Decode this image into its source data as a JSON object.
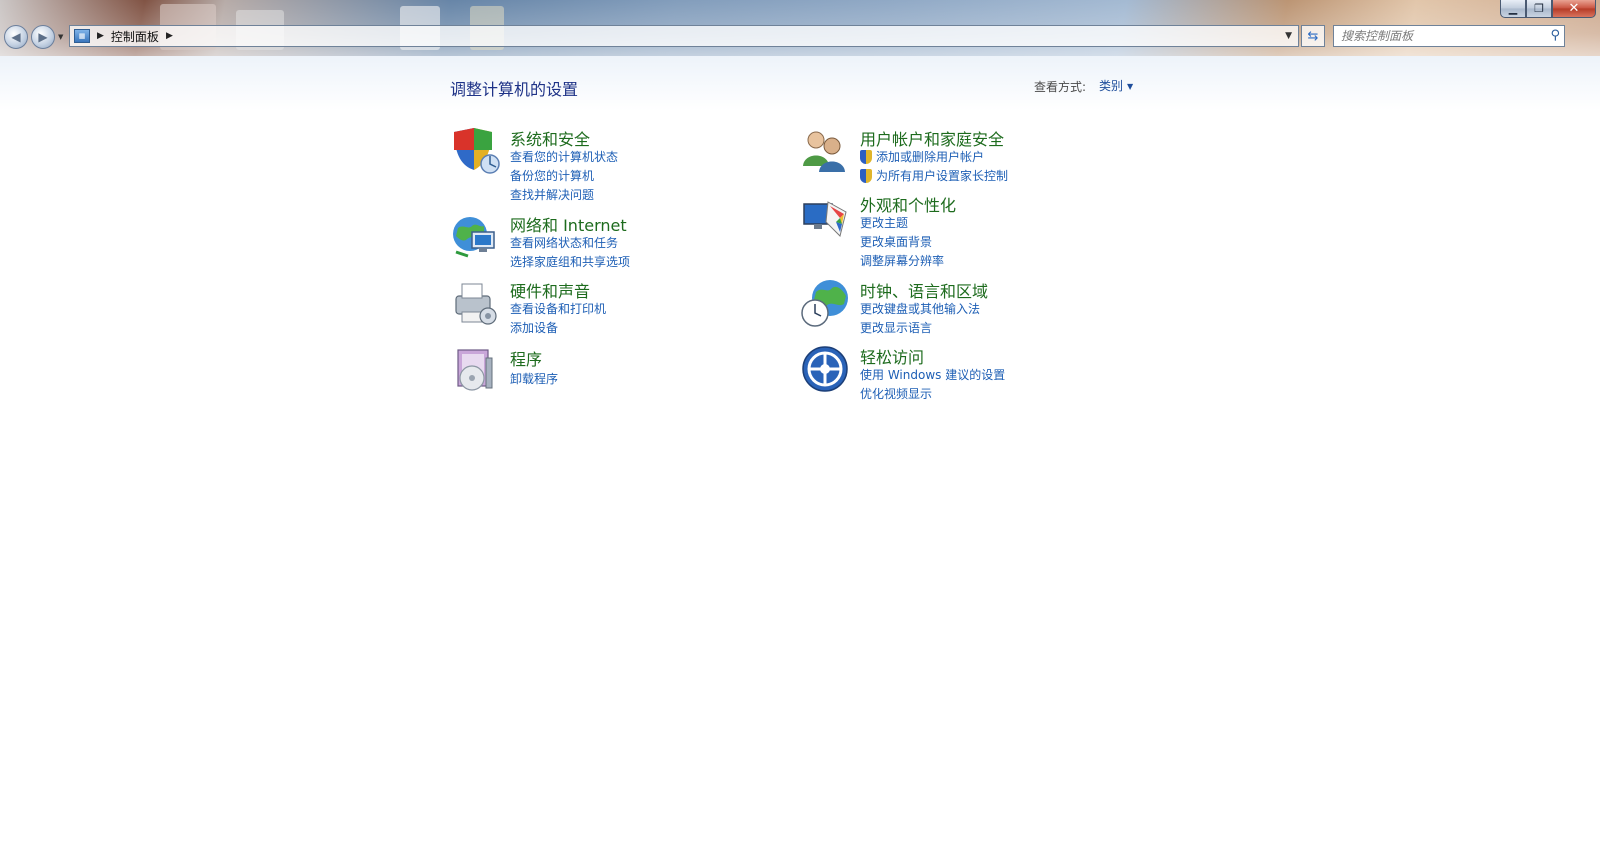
{
  "window": {
    "controls": {
      "minimize": "▁",
      "maximize": "❐",
      "close": "✕"
    }
  },
  "address_bar": {
    "breadcrumb": [
      "控制面板"
    ],
    "icon": "control-panel-icon"
  },
  "search": {
    "placeholder": "搜索控制面板"
  },
  "header": {
    "title": "调整计算机的设置",
    "view_by_label": "查看方式:",
    "view_by_value": "类别"
  },
  "categories": [
    {
      "id": "system-security",
      "icon": "shield-icon",
      "title": "系统和安全",
      "links": [
        "查看您的计算机状态",
        "备份您的计算机",
        "查找并解决问题"
      ]
    },
    {
      "id": "user-accounts",
      "icon": "users-icon",
      "title": "用户帐户和家庭安全",
      "links": [
        "添加或删除用户帐户",
        "为所有用户设置家长控制"
      ]
    },
    {
      "id": "network-internet",
      "icon": "network-globe-icon",
      "title": "网络和 Internet",
      "links": [
        "查看网络状态和任务",
        "选择家庭组和共享选项"
      ]
    },
    {
      "id": "appearance",
      "icon": "appearance-icon",
      "title": "外观和个性化",
      "links": [
        "更改主题",
        "更改桌面背景",
        "调整屏幕分辨率"
      ]
    },
    {
      "id": "hardware-sound",
      "icon": "printer-icon",
      "title": "硬件和声音",
      "links": [
        "查看设备和打印机",
        "添加设备"
      ]
    },
    {
      "id": "clock-region",
      "icon": "clock-globe-icon",
      "title": "时钟、语言和区域",
      "links": [
        "更改键盘或其他输入法",
        "更改显示语言"
      ]
    },
    {
      "id": "programs",
      "icon": "programs-icon",
      "title": "程序",
      "links": [
        "卸载程序"
      ]
    },
    {
      "id": "ease-of-access",
      "icon": "ease-of-access-icon",
      "title": "轻松访问",
      "links": [
        "使用 Windows 建议的设置",
        "优化视频显示"
      ]
    }
  ]
}
